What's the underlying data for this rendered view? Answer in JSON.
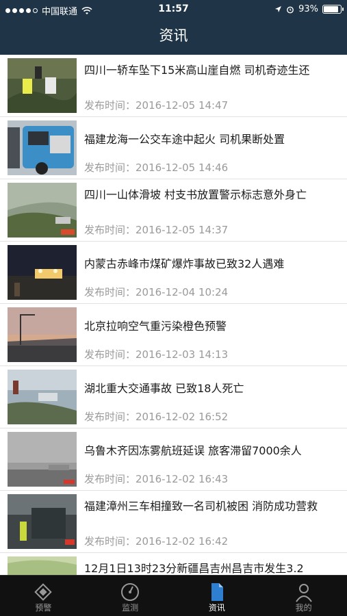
{
  "status_bar": {
    "carrier": "中国联通",
    "time": "11:57",
    "battery": "93%"
  },
  "header": {
    "title": "资讯"
  },
  "news": [
    {
      "headline": "四川一轿车坠下15米高山崖自燃 司机奇迹生还",
      "time": "发布时间：2016-12-05 14:47"
    },
    {
      "headline": "福建龙海一公交车途中起火 司机果断处置",
      "time": "发布时间：2016-12-05 14:46"
    },
    {
      "headline": "四川一山体滑坡 村支书放置警示标志意外身亡",
      "time": "发布时间：2016-12-05 14:37"
    },
    {
      "headline": "内蒙古赤峰市煤矿爆炸事故已致32人遇难",
      "time": "发布时间：2016-12-04 10:24"
    },
    {
      "headline": "北京拉响空气重污染橙色预警",
      "time": "发布时间：2016-12-03 14:13"
    },
    {
      "headline": "湖北重大交通事故 已致18人死亡",
      "time": "发布时间：2016-12-02 16:52"
    },
    {
      "headline": "乌鲁木齐因冻雾航班延误 旅客滞留7000余人",
      "time": "发布时间：2016-12-02 16:43"
    },
    {
      "headline": "福建漳州三车相撞致一名司机被困 消防成功营救",
      "time": "发布时间：2016-12-02 16:42"
    },
    {
      "headline": "12月1日13时23分新疆昌吉州昌吉市发生3.2",
      "time": ""
    }
  ],
  "tabs": [
    {
      "label": "预警",
      "icon": "warning-icon"
    },
    {
      "label": "监测",
      "icon": "gauge-icon"
    },
    {
      "label": "资讯",
      "icon": "document-icon"
    },
    {
      "label": "我的",
      "icon": "user-icon"
    }
  ],
  "colors": {
    "header_bg": "#1f3446",
    "tabbar_bg": "#111111",
    "time_gray": "#9a9a9a"
  }
}
